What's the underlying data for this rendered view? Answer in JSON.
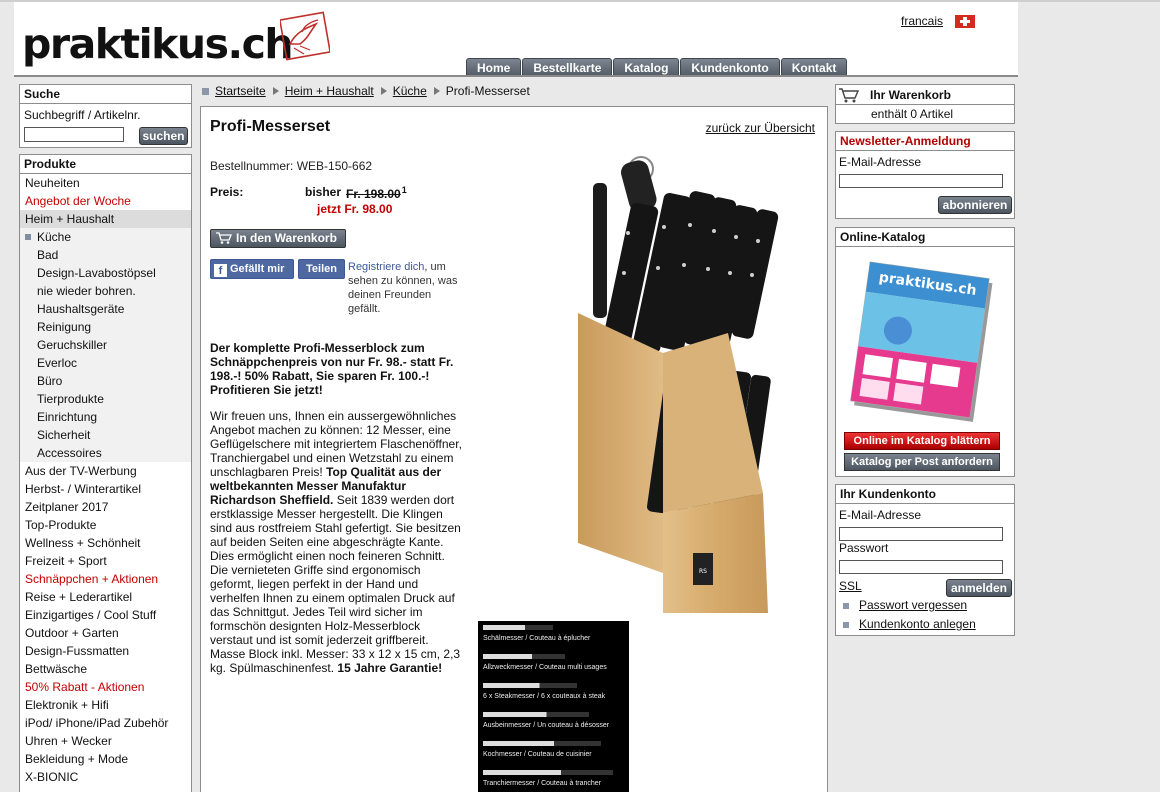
{
  "header": {
    "logo_text": "praktikus.ch",
    "language_link": "francais",
    "tabs": [
      "Home",
      "Bestellkarte",
      "Katalog",
      "Kundenkonto",
      "Kontakt"
    ]
  },
  "search": {
    "title": "Suche",
    "label": "Suchbegriff / Artikelnr.",
    "input_value": "",
    "button": "suchen"
  },
  "products": {
    "title": "Produkte",
    "items": [
      {
        "label": "Neuheiten",
        "style": "normal"
      },
      {
        "label": "Angebot der Woche",
        "style": "red"
      },
      {
        "label": "Heim + Haushalt",
        "style": "selected"
      },
      {
        "label": "Küche",
        "style": "sub-active"
      },
      {
        "label": "Bad",
        "style": "sub"
      },
      {
        "label": "Design-Lavabostöpsel",
        "style": "sub"
      },
      {
        "label": "nie wieder bohren.",
        "style": "sub"
      },
      {
        "label": "Haushaltsgeräte",
        "style": "sub"
      },
      {
        "label": "Reinigung",
        "style": "sub"
      },
      {
        "label": "Geruchskiller",
        "style": "sub"
      },
      {
        "label": "Everloc",
        "style": "sub"
      },
      {
        "label": "Büro",
        "style": "sub"
      },
      {
        "label": "Tierprodukte",
        "style": "sub"
      },
      {
        "label": "Einrichtung",
        "style": "sub"
      },
      {
        "label": "Sicherheit",
        "style": "sub"
      },
      {
        "label": "Accessoires",
        "style": "sub"
      },
      {
        "label": "Aus der TV-Werbung",
        "style": "normal"
      },
      {
        "label": "Herbst- / Winterartikel",
        "style": "normal"
      },
      {
        "label": "Zeitplaner 2017",
        "style": "normal"
      },
      {
        "label": "Top-Produkte",
        "style": "normal"
      },
      {
        "label": "Wellness + Schönheit",
        "style": "normal"
      },
      {
        "label": "Freizeit + Sport",
        "style": "normal"
      },
      {
        "label": "Schnäppchen + Aktionen",
        "style": "red"
      },
      {
        "label": "Reise + Lederartikel",
        "style": "normal"
      },
      {
        "label": "Einzigartiges / Cool Stuff",
        "style": "normal"
      },
      {
        "label": "Outdoor + Garten",
        "style": "normal"
      },
      {
        "label": "Design-Fussmatten",
        "style": "normal"
      },
      {
        "label": "Bettwäsche",
        "style": "normal"
      },
      {
        "label": "50% Rabatt - Aktionen",
        "style": "red"
      },
      {
        "label": "Elektronik + Hifi",
        "style": "normal"
      },
      {
        "label": "iPod/ iPhone/iPad Zubehör",
        "style": "normal"
      },
      {
        "label": "Uhren + Wecker",
        "style": "normal"
      },
      {
        "label": "Bekleidung + Mode",
        "style": "normal"
      },
      {
        "label": "X-BIONIC",
        "style": "normal"
      }
    ]
  },
  "breadcrumb": {
    "items": [
      "Startseite",
      "Heim + Haushalt",
      "Küche"
    ],
    "current": "Profi-Messerset"
  },
  "product": {
    "title": "Profi-Messerset",
    "back_link": "zurück zur Übersicht",
    "order_number": "Bestellnummer: WEB-150-662",
    "price_label": "Preis:",
    "old_price_label": "bisher",
    "old_price": "Fr. 198.00",
    "old_price_note": "1",
    "new_price": "jetzt Fr. 98.00",
    "cart_button": "In den Warenkorb",
    "fb_like": "Gefällt mir",
    "fb_share": "Teilen",
    "fb_register": "Registriere dich",
    "fb_text": ", um sehen zu können, was deinen Freunden gefällt.",
    "intro": "Der komplette Profi-Messerblock zum Schnäppchenpreis von nur Fr. 98.- statt Fr. 198.-! 50% Rabatt, Sie sparen Fr. 100.-! Profitieren Sie jetzt!",
    "desc_1": "Wir freuen uns, Ihnen ein aussergewöhnliches Angebot machen zu können: 12 Messer, eine Geflügelschere mit integriertem Flaschenöffner, Tranchiergabel und einen Wetzstahl zu einem unschlagbaren Preis! ",
    "desc_bold_1": "Top Qualität aus der weltbekannten Messer Manufaktur Richardson Sheffield.",
    "desc_2": " Seit 1839 werden dort erstklassige Messer hergestellt. Die Klingen sind aus rostfreiem Stahl gefertigt. Sie besitzen auf beiden Seiten eine abgeschrägte Kante. Dies ermöglicht einen noch feineren Schnitt. Die vernieteten Griffe sind ergonomisch geformt, liegen perfekt in der Hand und verhelfen Ihnen zu einem optimalen Druck auf das Schnittgut. Jedes Teil wird sicher im formschön designten Holz-Messerblock verstaut und ist somit jederzeit griffbereit. Masse Block inkl. Messer: 33 x 12 x 15 cm, 2,3 kg. Spülmaschinenfest. ",
    "desc_bold_2": "15 Jahre Garantie!",
    "legend": [
      "Schälmesser / Couteau à éplucher",
      "Allzweckmesser / Couteau multi usages",
      "6 x Steakmesser / 6 x couteaux à steak",
      "Ausbeinmesser / Un couteau à désosser",
      "Kochmesser / Couteau de cuisinier",
      "Tranchiermesser / Couteau à trancher"
    ]
  },
  "cart": {
    "title": "Ihr Warenkorb",
    "count_text": "enthält 0 Artikel"
  },
  "newsletter": {
    "title": "Newsletter-Anmeldung",
    "email_label": "E-Mail-Adresse",
    "email_value": "",
    "button": "abonnieren"
  },
  "catalog": {
    "title": "Online-Katalog",
    "cover_brand": "praktikus.ch",
    "btn_browse": "Online im Katalog blättern",
    "btn_order": "Katalog per Post anfordern"
  },
  "account": {
    "title": "Ihr Kundenkonto",
    "email_label": "E-Mail-Adresse",
    "password_label": "Passwort",
    "ssl": "SSL",
    "login": "anmelden",
    "forgot": "Passwort vergessen",
    "create": "Kundenkonto anlegen"
  }
}
